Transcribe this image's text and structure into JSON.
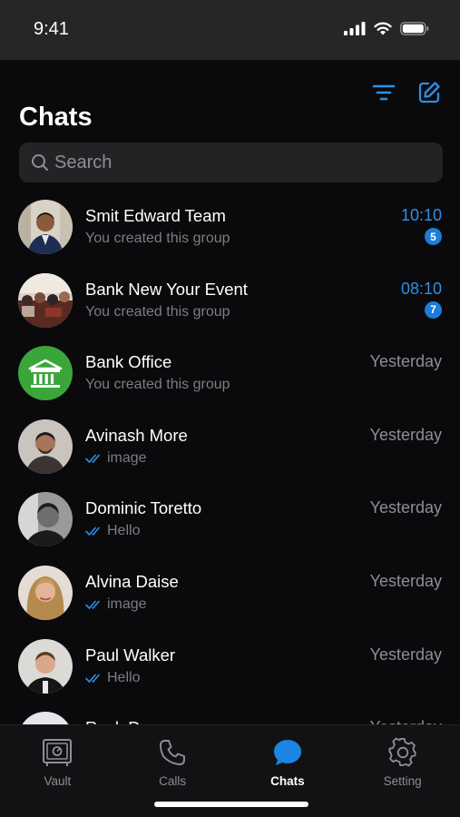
{
  "status_bar": {
    "time": "9:41"
  },
  "header": {
    "title": "Chats",
    "filter_icon": "filter-icon",
    "compose_icon": "compose-icon"
  },
  "search": {
    "placeholder": "Search"
  },
  "chats": [
    {
      "name": "Smit Edward Team",
      "subtitle": "You created this group",
      "time": "10:10",
      "unread": "5",
      "avatar": "group-photo",
      "read_ticks": false
    },
    {
      "name": "Bank New Your Event",
      "subtitle": "You created this group",
      "time": "08:10",
      "unread": "7",
      "avatar": "event-photo",
      "read_ticks": false
    },
    {
      "name": "Bank Office",
      "subtitle": "You created this group",
      "time": "Yesterday",
      "unread": null,
      "avatar": "bank-icon",
      "read_ticks": false
    },
    {
      "name": "Avinash More",
      "subtitle": "image",
      "time": "Yesterday",
      "unread": null,
      "avatar": "person-photo",
      "read_ticks": true
    },
    {
      "name": "Dominic Toretto",
      "subtitle": "Hello",
      "time": "Yesterday",
      "unread": null,
      "avatar": "person-photo",
      "read_ticks": true
    },
    {
      "name": "Alvina Daise",
      "subtitle": "image",
      "time": "Yesterday",
      "unread": null,
      "avatar": "person-photo",
      "read_ticks": true
    },
    {
      "name": "Paul Walker",
      "subtitle": "Hello",
      "time": "Yesterday",
      "unread": null,
      "avatar": "person-photo",
      "read_ticks": true
    },
    {
      "name": "Rock Dom",
      "subtitle": "",
      "time": "Yesterday",
      "unread": null,
      "avatar": "person-photo",
      "read_ticks": false
    }
  ],
  "tabs": [
    {
      "label": "Vault",
      "icon": "vault-icon",
      "active": false
    },
    {
      "label": "Calls",
      "icon": "phone-icon",
      "active": false
    },
    {
      "label": "Chats",
      "icon": "chat-bubble-icon",
      "active": true
    },
    {
      "label": "Setting",
      "icon": "gear-icon",
      "active": false
    }
  ],
  "colors": {
    "accent": "#2f8fe6",
    "badge": "#1c7cd8",
    "background": "#0a0a0c",
    "status_bar": "#262628",
    "search_bg": "#232325",
    "bank_avatar": "#3aa63a"
  }
}
